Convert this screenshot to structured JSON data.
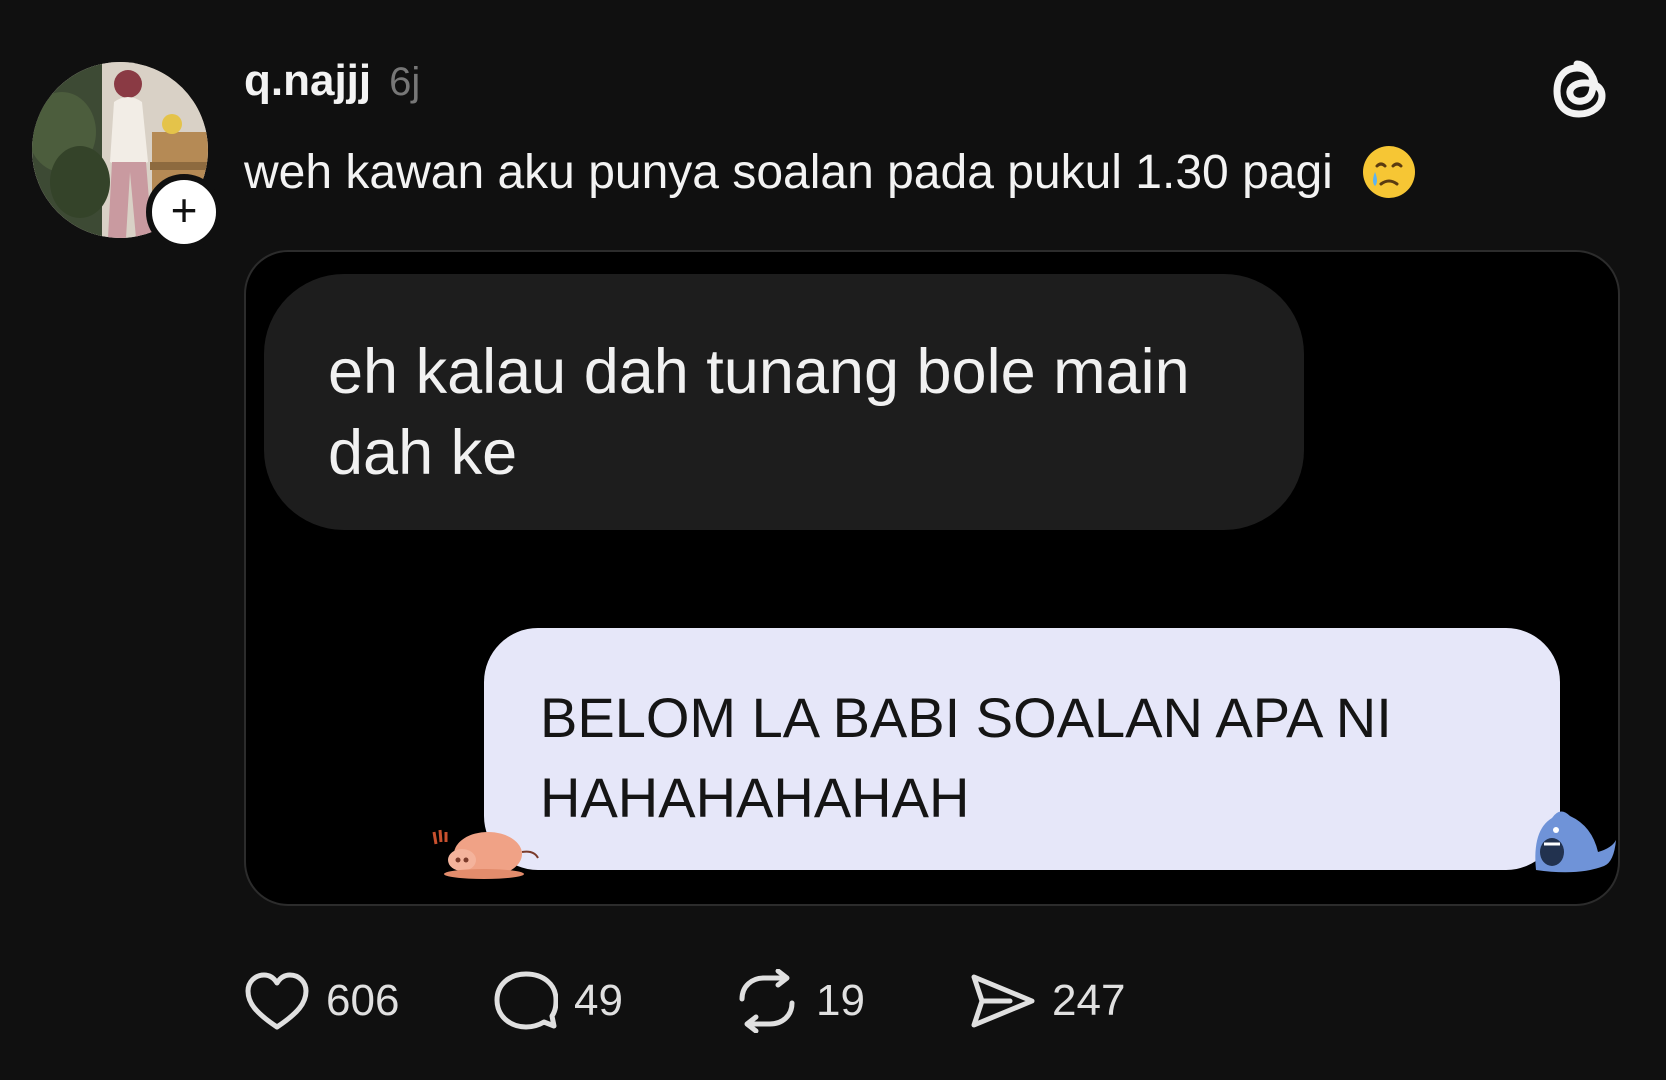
{
  "post": {
    "username": "q.najjj",
    "time": "6j",
    "caption": "weh kawan aku punya soalan pada pukul 1.30 pagi",
    "caption_emoji": "face-holding-back-tears",
    "follow_symbol": "+",
    "media": {
      "incoming_message": "eh kalau dah tunang bole main dah ke",
      "outgoing_message": "BELOM LA BABI SOALAN APA NI HAHAHAHAHAH",
      "outgoing_bubble_color": "#e6e7f9",
      "incoming_bubble_color": "#1d1d1d"
    },
    "actions": {
      "likes": "606",
      "replies": "49",
      "reposts": "19",
      "shares": "247"
    }
  },
  "colors": {
    "background": "#101010",
    "text": "#f3f3f3",
    "muted": "#777777"
  },
  "icons": [
    "threads-logo-icon",
    "heart-icon",
    "comment-icon",
    "repost-icon",
    "share-icon",
    "plus-icon"
  ]
}
